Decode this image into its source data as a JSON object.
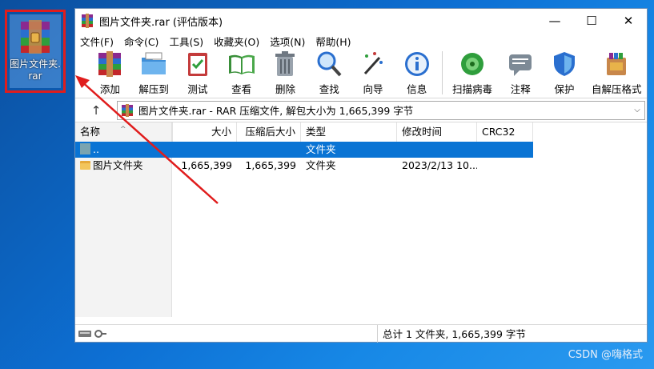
{
  "desktop": {
    "icon_label": "图片文件夹.rar",
    "watermark": "CSDN @嗨格式"
  },
  "window": {
    "title": "图片文件夹.rar (评估版本)",
    "controls": {
      "minimize": "—",
      "maximize": "☐",
      "close": "✕"
    },
    "menu": [
      "文件(F)",
      "命令(C)",
      "工具(S)",
      "收藏夹(O)",
      "选项(N)",
      "帮助(H)"
    ],
    "toolbar": [
      {
        "label": "添加",
        "icon": "add-archive-icon"
      },
      {
        "label": "解压到",
        "icon": "extract-folder-icon"
      },
      {
        "label": "测试",
        "icon": "test-clipboard-icon"
      },
      {
        "label": "查看",
        "icon": "view-book-icon"
      },
      {
        "label": "删除",
        "icon": "trash-bin-icon"
      },
      {
        "label": "查找",
        "icon": "magnifier-icon"
      },
      {
        "label": "向导",
        "icon": "magic-wand-icon"
      },
      {
        "label": "信息",
        "icon": "info-icon"
      },
      {
        "label": "扫描病毒",
        "icon": "virus-scan-icon"
      },
      {
        "label": "注释",
        "icon": "comment-icon"
      },
      {
        "label": "保护",
        "icon": "shield-icon"
      },
      {
        "label": "自解压格式",
        "icon": "sfx-archive-icon"
      }
    ],
    "address": {
      "path": "图片文件夹.rar - RAR 压缩文件, 解包大小为 1,665,399 字节",
      "dropdown": "⌵",
      "up": "↑"
    },
    "columns": [
      "名称",
      "大小",
      "压缩后大小",
      "类型",
      "修改时间",
      "CRC32"
    ],
    "rows": [
      {
        "name": "..",
        "size": "",
        "csize": "",
        "type": "文件夹",
        "time": "",
        "crc": "",
        "selected": true
      },
      {
        "name": "图片文件夹",
        "size": "1,665,399",
        "csize": "1,665,399",
        "type": "文件夹",
        "time": "2023/2/13 10...",
        "crc": "",
        "selected": false
      }
    ],
    "status": "总计 1 文件夹, 1,665,399 字节"
  },
  "colors": {
    "accent": "#0a74d4",
    "highlight_border": "#e01d1d",
    "desktop": "#0d6fd3"
  }
}
